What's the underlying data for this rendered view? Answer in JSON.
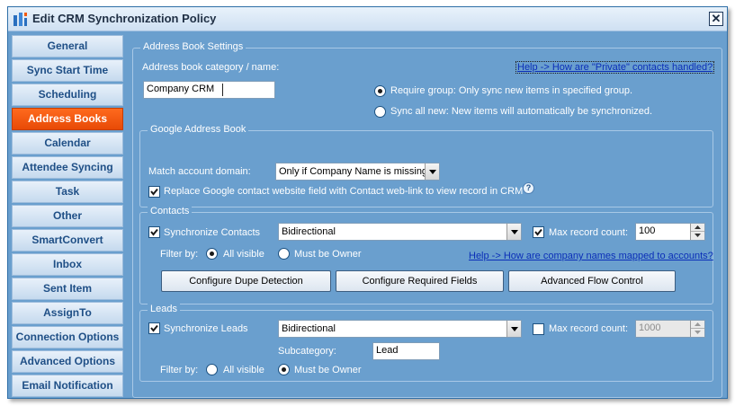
{
  "window": {
    "title": "Edit CRM Synchronization Policy"
  },
  "sidebar": {
    "items": [
      {
        "label": "General",
        "active": false
      },
      {
        "label": "Sync Start Time",
        "active": false
      },
      {
        "label": "Scheduling",
        "active": false
      },
      {
        "label": "Address Books",
        "active": true
      },
      {
        "label": "Calendar",
        "active": false
      },
      {
        "label": "Attendee Syncing",
        "active": false
      },
      {
        "label": "Task",
        "active": false
      },
      {
        "label": "Other",
        "active": false
      },
      {
        "label": "SmartConvert",
        "active": false
      },
      {
        "label": "Inbox",
        "active": false
      },
      {
        "label": "Sent Item",
        "active": false
      },
      {
        "label": "AssignTo",
        "active": false
      },
      {
        "label": "Connection Options",
        "active": false
      },
      {
        "label": "Advanced Options",
        "active": false
      },
      {
        "label": "Email Notification",
        "active": false
      }
    ]
  },
  "address_book": {
    "legend": "Address Book Settings",
    "category_label": "Address book category / name:",
    "category_value": "Company CRM",
    "help_private_link": "Help -> How are \"Private\" contacts handled?",
    "require_group_label": "Require group: Only sync new items in specified group.",
    "require_group_selected": true,
    "sync_all_label": "Sync all new: New items will automatically be synchronized.",
    "sync_all_selected": false
  },
  "google": {
    "legend": "Google Address Book",
    "match_domain_label": "Match account domain:",
    "match_domain_value": "Only if Company Name is missing",
    "replace_website_label": "Replace Google contact website field with Contact web-link to view record in CRM",
    "replace_website_checked": true
  },
  "contacts": {
    "legend": "Contacts",
    "sync_label": "Synchronize Contacts",
    "sync_checked": true,
    "direction_value": "Bidirectional",
    "max_label": "Max record count:",
    "max_checked": true,
    "max_value": "100",
    "filter_label": "Filter by:",
    "all_visible_label": "All visible",
    "all_visible_selected": true,
    "must_be_owner_label": "Must be Owner",
    "must_be_owner_selected": false,
    "help_company_link": "Help -> How are company names mapped to accounts?",
    "btn_dupe": "Configure Dupe Detection",
    "btn_required": "Configure Required Fields",
    "btn_flow": "Advanced Flow Control"
  },
  "leads": {
    "legend": "Leads",
    "sync_label": "Synchronize Leads",
    "sync_checked": true,
    "direction_value": "Bidirectional",
    "max_label": "Max record count:",
    "max_checked": false,
    "max_value": "1000",
    "subcategory_label": "Subcategory:",
    "subcategory_value": "Lead",
    "filter_label": "Filter by:",
    "all_visible_label": "All visible",
    "all_visible_selected": false,
    "must_be_owner_label": "Must be Owner",
    "must_be_owner_selected": true
  },
  "colors": {
    "panel_bg": "#6a9fce",
    "active_tab": "#f25a10",
    "link": "#0b2fb8"
  },
  "icons": {
    "app": "crm-app-icon",
    "close": "close-icon",
    "help": "question-icon",
    "dropdown": "chevron-down-icon"
  }
}
